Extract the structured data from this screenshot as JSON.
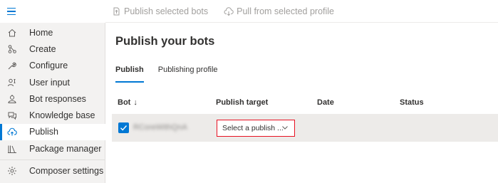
{
  "sidebar": {
    "items": [
      {
        "label": "Home",
        "icon": "home-icon"
      },
      {
        "label": "Create",
        "icon": "flow-icon"
      },
      {
        "label": "Configure",
        "icon": "wrench-icon"
      },
      {
        "label": "User input",
        "icon": "user-input-icon"
      },
      {
        "label": "Bot responses",
        "icon": "bot-icon"
      },
      {
        "label": "Knowledge base",
        "icon": "chat-icon"
      },
      {
        "label": "Publish",
        "icon": "cloud-upload-icon",
        "active": true
      },
      {
        "label": "Package manager",
        "icon": "library-icon"
      }
    ],
    "settings_label": "Composer settings"
  },
  "toolbar": {
    "publish_selected": "Publish selected bots",
    "pull_from_profile": "Pull from selected profile"
  },
  "main": {
    "title": "Publish your bots",
    "tabs": [
      {
        "label": "Publish",
        "active": true
      },
      {
        "label": "Publishing profile",
        "active": false
      }
    ],
    "table": {
      "headers": {
        "bot": "Bot",
        "bot_sort": "↓",
        "target": "Publish target",
        "date": "Date",
        "status": "Status"
      },
      "rows": [
        {
          "bot": "RCoreWithQnA",
          "target_placeholder": "Select a publish ...",
          "date": "",
          "status": "",
          "checked": true
        }
      ]
    }
  },
  "colors": {
    "accent": "#0078d4",
    "highlight_border": "#e81123",
    "sidebar_bg": "#f3f2f1",
    "row_bg": "#edebe9"
  }
}
